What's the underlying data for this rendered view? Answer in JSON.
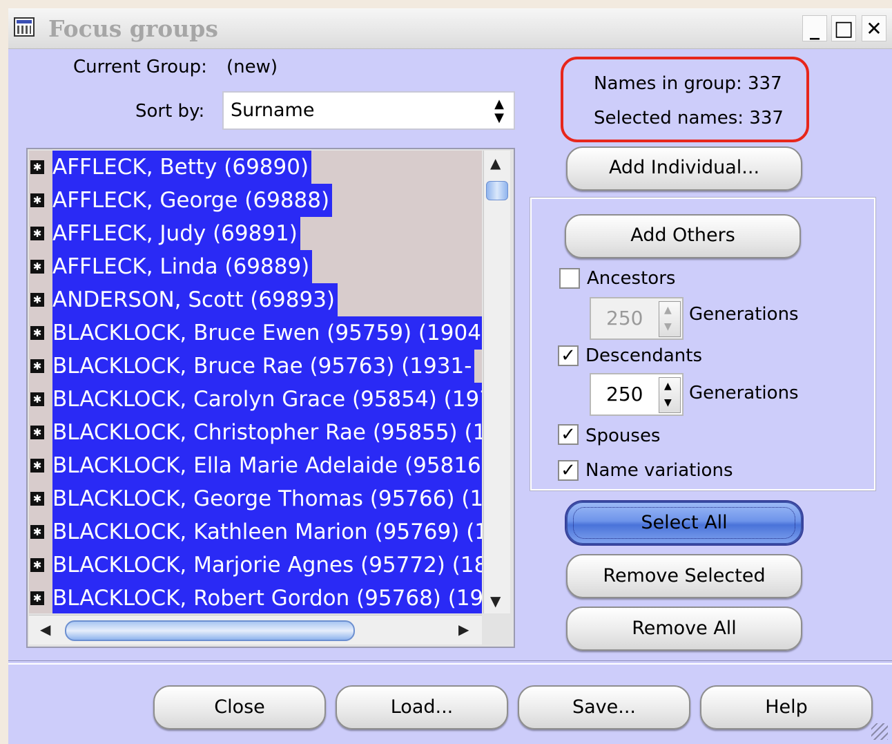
{
  "window": {
    "title": "Focus groups",
    "controls": {
      "minimize": "_",
      "maximize": "□",
      "close": "✕"
    }
  },
  "header": {
    "current_group_label": "Current Group:",
    "current_group_value": "(new)",
    "sort_by_label": "Sort by:",
    "sort_by_value": "Surname"
  },
  "counts": {
    "names_in_group": "Names in group: 337",
    "selected_names": "Selected names: 337"
  },
  "list": {
    "items": [
      "AFFLECK, Betty (69890)",
      "AFFLECK, George (69888)",
      "AFFLECK, Judy (69891)",
      "AFFLECK, Linda (69889)",
      "ANDERSON, Scott (69893)",
      "BLACKLOCK, Bruce Ewen (95759) (1904-",
      "BLACKLOCK, Bruce Rae (95763) (1931-",
      "BLACKLOCK, Carolyn Grace (95854) (197",
      "BLACKLOCK, Christopher Rae (95855) (1",
      "BLACKLOCK, Ella Marie Adelaide (95816)",
      "BLACKLOCK, George Thomas (95766) (1",
      "BLACKLOCK, Kathleen Marion (95769) (1",
      "BLACKLOCK, Marjorie Agnes (95772) (18",
      "BLACKLOCK, Robert Gordon (95768) (19"
    ],
    "row_icon": "person-marker-icon"
  },
  "buttons": {
    "add_individual": "Add Individual...",
    "add_others": "Add Others",
    "select_all": "Select All",
    "remove_selected": "Remove Selected",
    "remove_all": "Remove All",
    "close": "Close",
    "load": "Load...",
    "save": "Save...",
    "help": "Help"
  },
  "options": {
    "ancestors": {
      "label": "Ancestors",
      "checked": false,
      "generations": "250",
      "enabled": false
    },
    "descendants": {
      "label": "Descendants",
      "checked": true,
      "generations": "250",
      "enabled": true
    },
    "spouses": {
      "label": "Spouses",
      "checked": true
    },
    "name_variations": {
      "label": "Name variations",
      "checked": true
    },
    "generations_label": "Generations"
  },
  "colors": {
    "window_bg": "#cdcdfa",
    "selection": "#2a2af5",
    "highlight_ring": "#e7261b",
    "default_button": "#6e94ea"
  }
}
